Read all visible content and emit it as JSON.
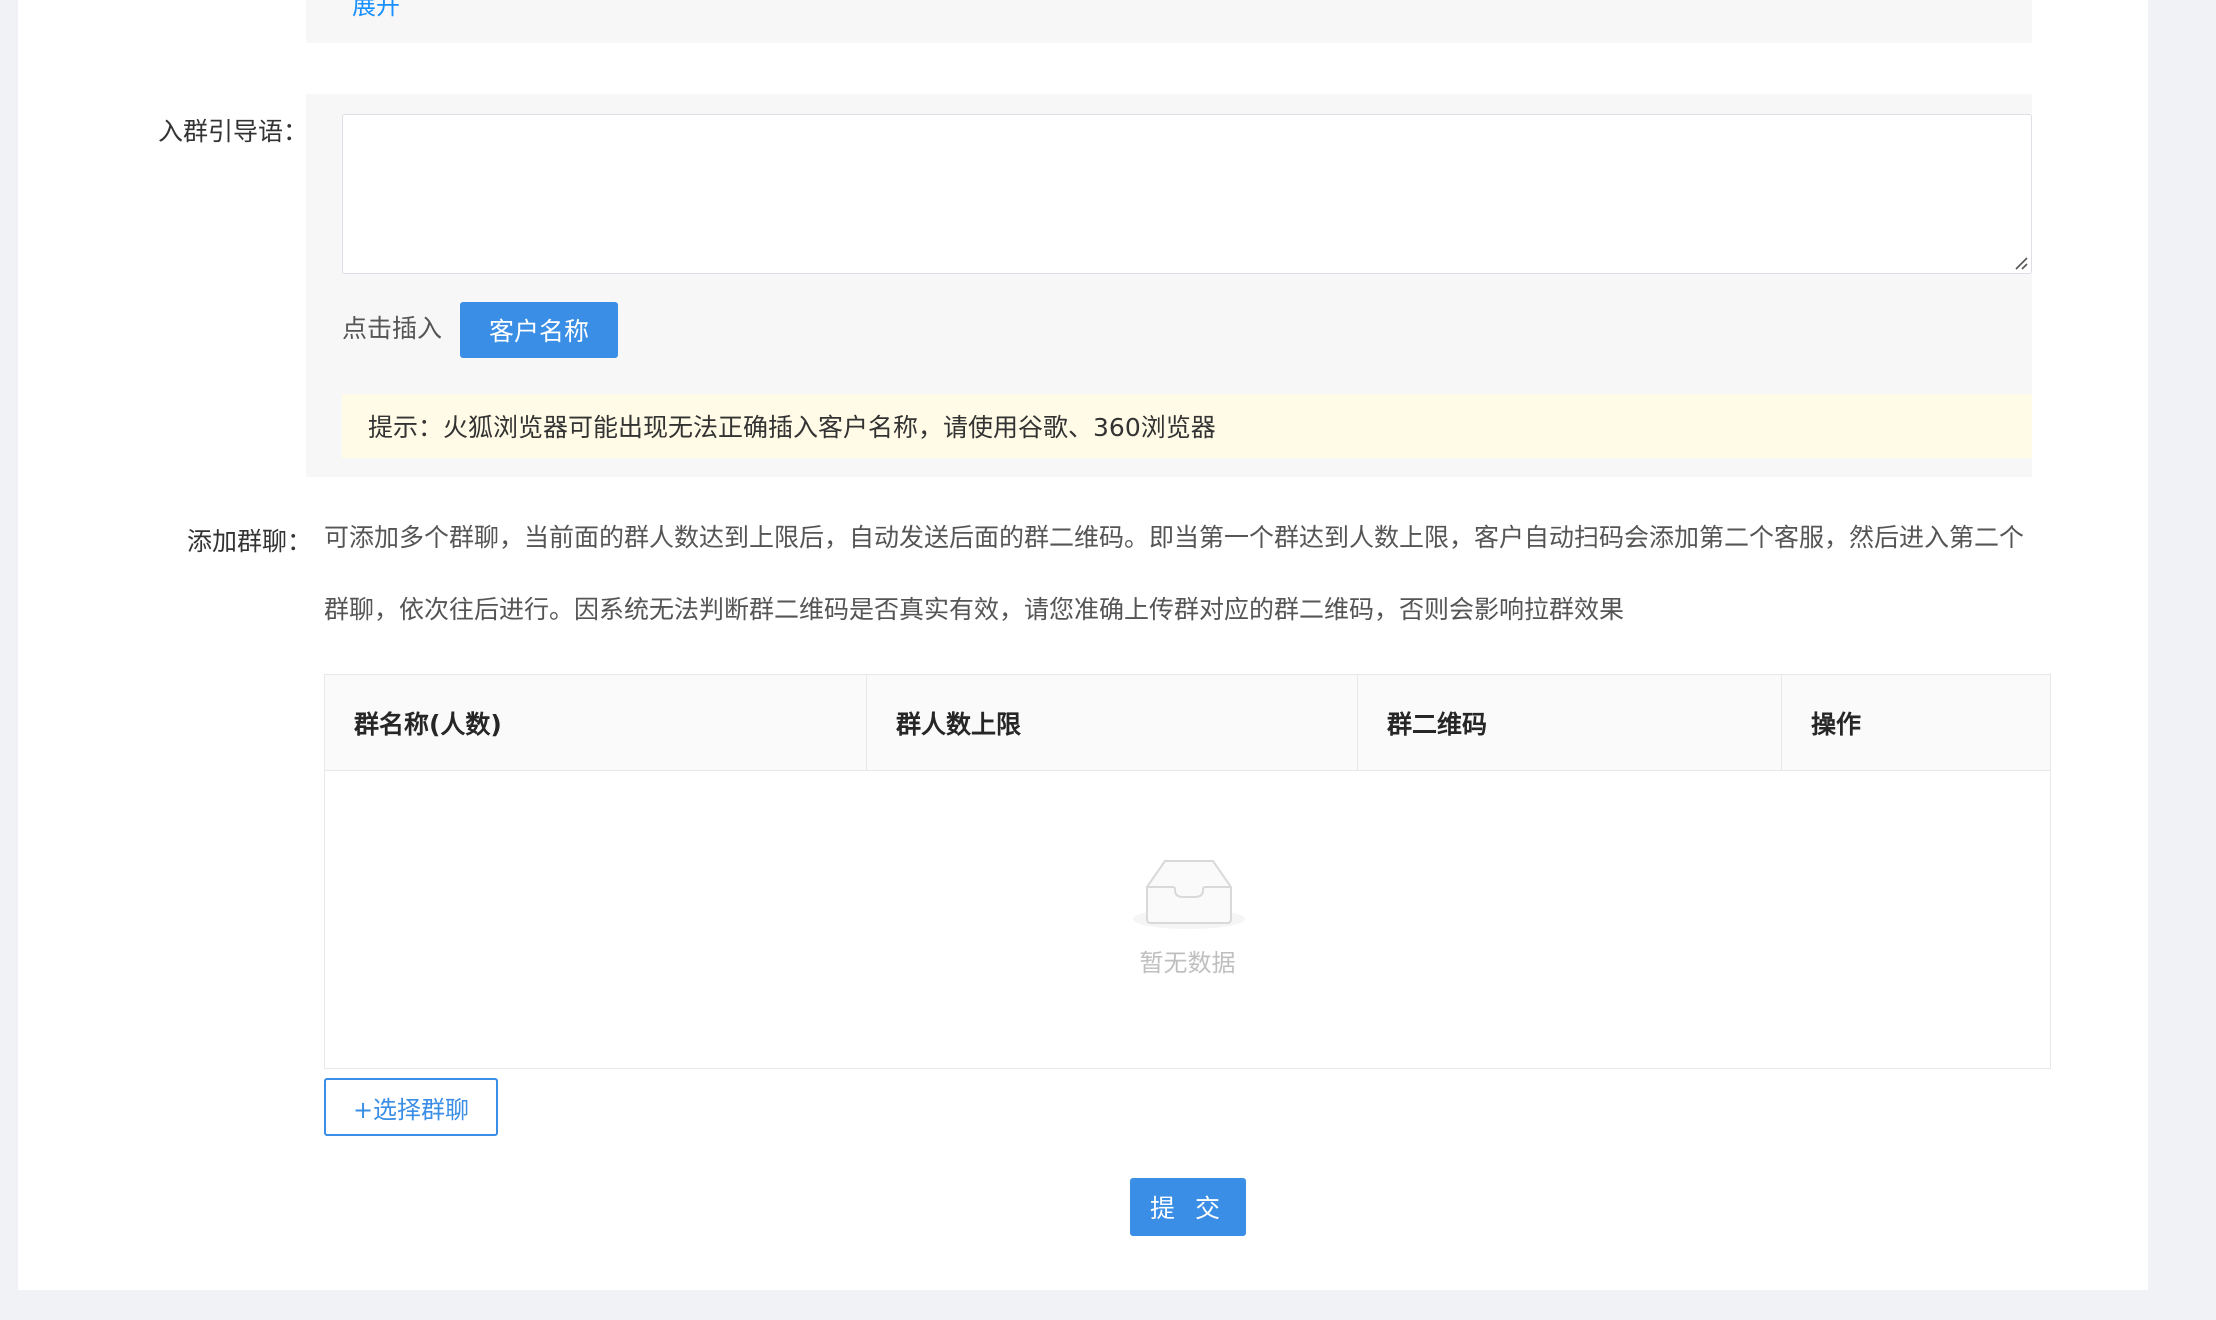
{
  "top_section": {
    "expand_link": "展开"
  },
  "guide": {
    "label": "入群引导语：",
    "textarea_value": "",
    "insert_label": "点击插入",
    "insert_button": "客户名称",
    "tip": "提示：火狐浏览器可能出现无法正确插入客户名称，请使用谷歌、360浏览器"
  },
  "add_group": {
    "label": "添加群聊：",
    "description_line1": "可添加多个群聊，当前面的群人数达到上限后，自动发送后面的群二维码。即当第一个群达到人数上限，客户自动扫码会添加第二个客服，然后进入第二个",
    "description_line2": "群聊，依次往后进行。因系统无法判断群二维码是否真实有效，请您准确上传群对应的群二维码，否则会影响拉群效果",
    "table": {
      "columns": [
        "群名称(人数)",
        "群人数上限",
        "群二维码",
        "操作"
      ],
      "empty_text": "暂无数据"
    },
    "select_button": "+选择群聊"
  },
  "submit_button": "提 交",
  "colors": {
    "primary": "#3a8ee6",
    "link": "#1890ff",
    "tip_background": "#fffbe6",
    "panel_background": "#f7f7f7",
    "page_background": "#f0f2f5"
  }
}
